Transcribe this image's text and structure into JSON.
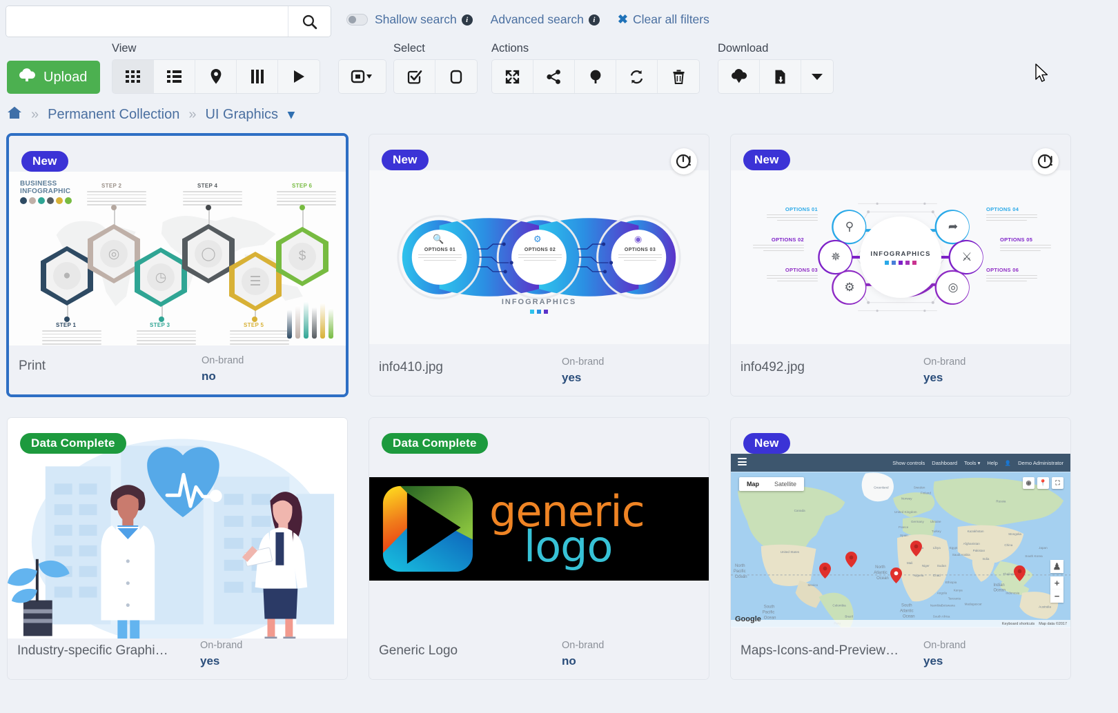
{
  "search": {
    "value": "",
    "placeholder": "",
    "search_icon": "magnifier-icon",
    "shallow_search_label": "Shallow search",
    "shallow_search_info": "i",
    "advanced_search_label": "Advanced search",
    "advanced_search_info": "i",
    "clear_filters_label": "Clear all filters",
    "clear_filters_icon": "x-icon"
  },
  "toolbar": {
    "upload_label": "Upload",
    "upload_icon": "cloud-upload-icon",
    "groups": [
      {
        "label": "View",
        "buttons": [
          {
            "name": "view-grid",
            "icon": "grid-icon",
            "active": true
          },
          {
            "name": "view-list",
            "icon": "list-icon",
            "active": false
          },
          {
            "name": "view-map",
            "icon": "map-pin-icon",
            "active": false
          },
          {
            "name": "view-columns",
            "icon": "columns-icon",
            "active": false
          },
          {
            "name": "view-slideshow",
            "icon": "play-icon",
            "active": false
          }
        ]
      },
      {
        "label": "",
        "buttons": [
          {
            "name": "display-options",
            "icon": "display-dropdown-icon",
            "active": false
          }
        ]
      },
      {
        "label": "Select",
        "buttons": [
          {
            "name": "select-all",
            "icon": "check-square-icon",
            "active": false
          },
          {
            "name": "select-none",
            "icon": "empty-square-icon",
            "active": false
          }
        ]
      },
      {
        "label": "Actions",
        "buttons": [
          {
            "name": "expand",
            "icon": "expand-arrows-icon",
            "active": false
          },
          {
            "name": "share",
            "icon": "share-icon",
            "active": false
          },
          {
            "name": "tree",
            "icon": "tree-icon",
            "active": false
          },
          {
            "name": "refresh",
            "icon": "refresh-icon",
            "active": false
          },
          {
            "name": "delete",
            "icon": "trash-icon",
            "active": false
          }
        ]
      },
      {
        "label": "Download",
        "buttons": [
          {
            "name": "download",
            "icon": "cloud-download-icon",
            "active": false
          },
          {
            "name": "download-options",
            "icon": "file-download-icon",
            "active": false
          },
          {
            "name": "download-menu",
            "icon": "caret-down-icon",
            "active": false
          }
        ]
      }
    ]
  },
  "breadcrumb": {
    "home_icon": "home-icon",
    "separator": "»",
    "items": [
      "Permanent Collection",
      "UI Graphics"
    ],
    "dropdown_icon": "chevron-down-icon"
  },
  "grid": {
    "meta_label": "On-brand",
    "cards": [
      {
        "title": "Print",
        "badge": "New",
        "badge_type": "new",
        "meta_label": "On-brand",
        "meta_value": "no",
        "selected": true,
        "corner_icon": null,
        "thumb": "hex-steps-infographic",
        "thumb_text": {
          "logo_line1": "BUSINESS",
          "logo_line2": "INFOGRAPHIC",
          "steps": [
            "STEP 1",
            "STEP 2",
            "STEP 3",
            "STEP 4",
            "STEP 5",
            "STEP 6"
          ],
          "step_colors": [
            "#2e4a63",
            "#bfb0a8",
            "#2fa594",
            "#555b5f",
            "#d8b136",
            "#77bb41"
          ],
          "step_icons": [
            "👤",
            "◎",
            "◴",
            "●",
            "≡",
            "$"
          ]
        }
      },
      {
        "title": "info410.jpg",
        "badge": "New",
        "badge_type": "new",
        "meta_label": "On-brand",
        "meta_value": "yes",
        "selected": false,
        "corner_icon": "pending-clock-alert-icon",
        "thumb": "blob-options-infographic",
        "thumb_text": {
          "caption": "INFOGRAPHICS",
          "options": [
            "OPTIONS 01",
            "OPTIONS 02",
            "OPTIONS 03"
          ],
          "option_icons": [
            "🔍",
            "⚙",
            "◉"
          ],
          "gradient_from": "#2ec3ec",
          "gradient_mid": "#2b8fe3",
          "gradient_to": "#5b33c9"
        }
      },
      {
        "title": "info492.jpg",
        "badge": "New",
        "badge_type": "new",
        "meta_label": "On-brand",
        "meta_value": "yes",
        "selected": false,
        "corner_icon": "pending-clock-alert-icon",
        "thumb": "radial-options-infographic",
        "thumb_text": {
          "hub_caption": "INFOGRAPHICS",
          "options": [
            "OPTIONS 01",
            "OPTIONS 02",
            "OPTIONS 03",
            "OPTIONS 04",
            "OPTIONS 05",
            "OPTIONS 06"
          ],
          "option_icons": [
            "⚷",
            "✹",
            "⚙",
            "✈",
            "⚇",
            "◈"
          ],
          "accent_blue": "#2aa9e8",
          "accent_purple": "#7e22c8"
        }
      },
      {
        "title": "Industry-specific Graphi…",
        "badge": "Data Complete",
        "badge_type": "data",
        "meta_label": "On-brand",
        "meta_value": "yes",
        "selected": false,
        "corner_icon": null,
        "thumb": "healthcare-illustration",
        "thumb_text": {
          "accent": "#4fa0e8"
        }
      },
      {
        "title": "Generic Logo",
        "badge": "Data Complete",
        "badge_type": "data",
        "meta_label": "On-brand",
        "meta_value": "no",
        "selected": false,
        "corner_icon": null,
        "thumb": "generic-logo-image",
        "thumb_text": {
          "word1": "generic",
          "word2": "logo",
          "word1_color": "#ef8424",
          "word2_color": "#37c2d6",
          "background": "#000000"
        }
      },
      {
        "title": "Maps-Icons-and-Preview…",
        "badge": "New",
        "badge_type": "new",
        "meta_label": "On-brand",
        "meta_value": "yes",
        "selected": false,
        "corner_icon": null,
        "thumb": "world-map-screenshot",
        "thumb_text": {
          "nav_items": [
            "Show controls",
            "Dashboard",
            "Tools ▾",
            "Help",
            "Demo Administrator"
          ],
          "map_button": "Map",
          "satellite_button": "Satellite",
          "brand": "Google",
          "footer_left": "Keyboard shortcuts",
          "footer_right": "Map data ©2017",
          "zoom_in": "+",
          "zoom_out": "−",
          "ocean_labels": [
            "North Atlantic Ocean",
            "South Atlantic Ocean",
            "North Pacific Ocean",
            "South Pacific Ocean",
            "Indian Ocean"
          ],
          "marker_count": 5
        }
      }
    ]
  },
  "cursor": {
    "icon": "mouse-pointer-icon"
  },
  "colors": {
    "accent_green": "#4cb050",
    "accent_blue": "#2e6fc4",
    "badge_new": "#3b33d6",
    "badge_data": "#1d9a3e",
    "page_bg": "#eef1f6",
    "link": "#4a6fa0"
  }
}
